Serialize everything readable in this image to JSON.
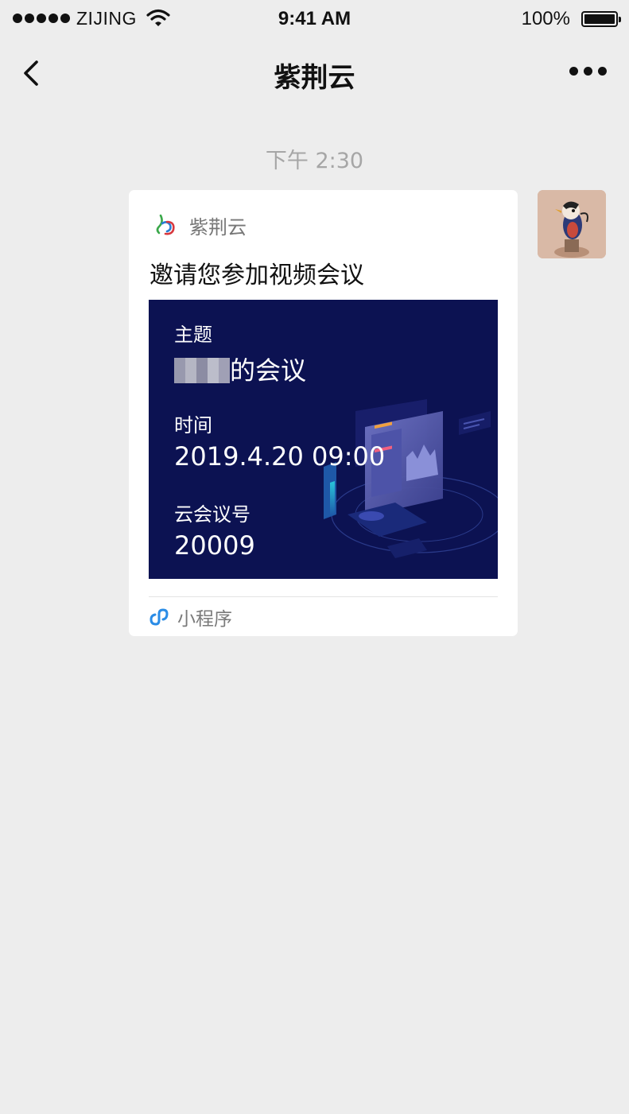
{
  "status_bar": {
    "carrier": "ZIJING",
    "time": "9:41 AM",
    "battery": "100%"
  },
  "nav": {
    "title": "紫荆云"
  },
  "chat": {
    "timestamp": "下午 2:30",
    "message": {
      "app_name": "紫荆云",
      "title": "邀请您参加视频会议",
      "preview": {
        "topic_label": "主题",
        "topic_value": "的会议",
        "time_label": "时间",
        "time_value": "2019.4.20 09:00",
        "meeting_id_label": "云会议号",
        "meeting_id_value": "20009"
      },
      "footer_label": "小程序"
    }
  },
  "colors": {
    "background": "#ededed",
    "card": "#ffffff",
    "preview_bg": "#0c1252",
    "mini_program_blue": "#2a8ce6"
  }
}
